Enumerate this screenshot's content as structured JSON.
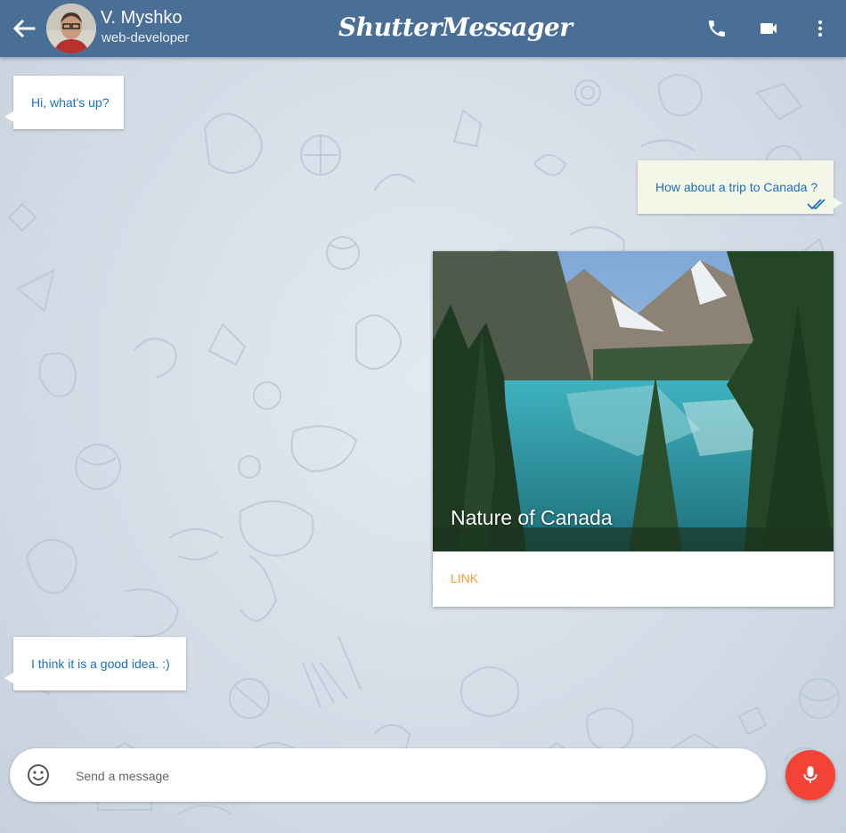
{
  "header": {
    "contact_name": "V. Myshko",
    "contact_status": "web-developer",
    "brand": "ShutterMessager",
    "icons": [
      "back-arrow-icon",
      "phone-icon",
      "video-call-icon",
      "more-vert-icon"
    ]
  },
  "messages": [
    {
      "direction": "incoming",
      "text": "Hi, what's up?"
    },
    {
      "direction": "outgoing",
      "text": "How about a trip to Canada ?",
      "status": "read"
    },
    {
      "direction": "outgoing",
      "type": "card",
      "title": "Nature of Canada",
      "link_label": "LINK"
    },
    {
      "direction": "incoming",
      "text": "I think it is a good idea. :)"
    }
  ],
  "composer": {
    "placeholder": "Send a message",
    "value": "",
    "icons": [
      "emoji-icon",
      "mic-icon"
    ]
  },
  "colors": {
    "header_bg": "#4a6f97",
    "message_text": "#1e6fb9",
    "outgoing_bubble": "#f2f7e8",
    "link": "#ff9a2e",
    "mic_button": "#f44336"
  }
}
